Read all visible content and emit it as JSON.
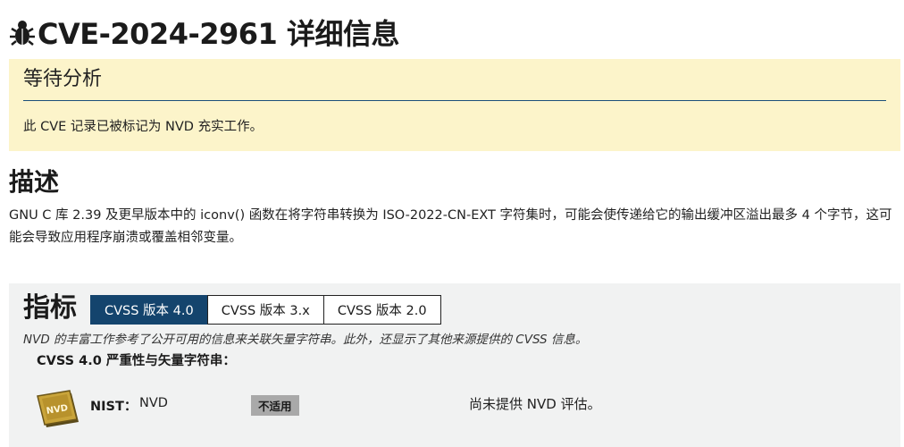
{
  "page": {
    "title": "CVE-2024-2961 详细信息",
    "title_icon": "bug-icon"
  },
  "await_analysis": {
    "title": "等待分析",
    "text": "此 CVE 记录已被标记为 NVD 充实工作。",
    "background": "#fcf4ca",
    "rule_color": "#1b4f7a"
  },
  "description": {
    "heading": "描述",
    "text": "GNU C 库 2.39 及更早版本中的 iconv() 函数在将字符串转换为 ISO-2022-CN-EXT 字符集时，可能会使传递给它的输出缓冲区溢出最多 4 个字节，这可能会导致应用程序崩溃或覆盖相邻变量。"
  },
  "metrics": {
    "heading": "指标",
    "tabs": [
      {
        "label": "CVSS 版本 4.0",
        "active": true
      },
      {
        "label": "CVSS 版本 3.x",
        "active": false
      },
      {
        "label": "CVSS 版本 2.0",
        "active": false
      }
    ],
    "active_tab_color": "#14446d",
    "note": "NVD 的丰富工作参考了公开可用的信息来关联矢量字符串。此外，还显示了其他来源提供的 CVSS 信息。",
    "cvss_label": "CVSS 4.0 严重性与矢量字符串：",
    "nist_row": {
      "logo_icon": "nvd-logo-icon",
      "logo_text": "NVD",
      "label": "NIST：",
      "source": "NVD",
      "badge": "不适用",
      "note": "尚未提供 NVD 评估。"
    }
  }
}
